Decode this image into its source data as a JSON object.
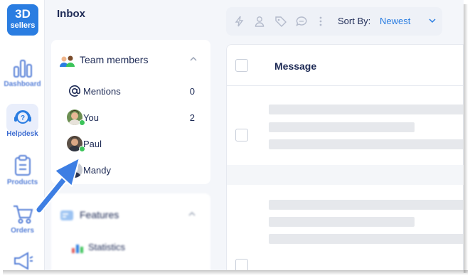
{
  "logo": {
    "line1": "3D",
    "line2": "sellers"
  },
  "rail": {
    "items": [
      {
        "label": "Dashboard",
        "icon": "bar-chart-icon"
      },
      {
        "label": "Helpdesk",
        "icon": "headset-icon",
        "active": true
      },
      {
        "label": "Products",
        "icon": "clipboard-icon"
      },
      {
        "label": "Orders",
        "icon": "cart-icon"
      },
      {
        "label": "",
        "icon": "megaphone-icon"
      }
    ]
  },
  "inbox": {
    "title": "Inbox",
    "team": {
      "header": "Team members",
      "members": [
        {
          "name": "Mentions",
          "count": "0",
          "icon": "at-icon"
        },
        {
          "name": "You",
          "count": "2",
          "icon": "avatar"
        },
        {
          "name": "Paul",
          "count": "",
          "icon": "avatar"
        },
        {
          "name": "Mandy",
          "count": "",
          "icon": "avatar"
        }
      ]
    },
    "features": {
      "header": "Features",
      "items": [
        "Statistics"
      ]
    }
  },
  "toolbar": {
    "sort_label": "Sort By:",
    "sort_value": "Newest"
  },
  "table": {
    "header": "Message"
  },
  "colors": {
    "accent": "#2a7de1",
    "presence": "#3cc45a",
    "annotation_arrow": "#3d7ee3"
  }
}
